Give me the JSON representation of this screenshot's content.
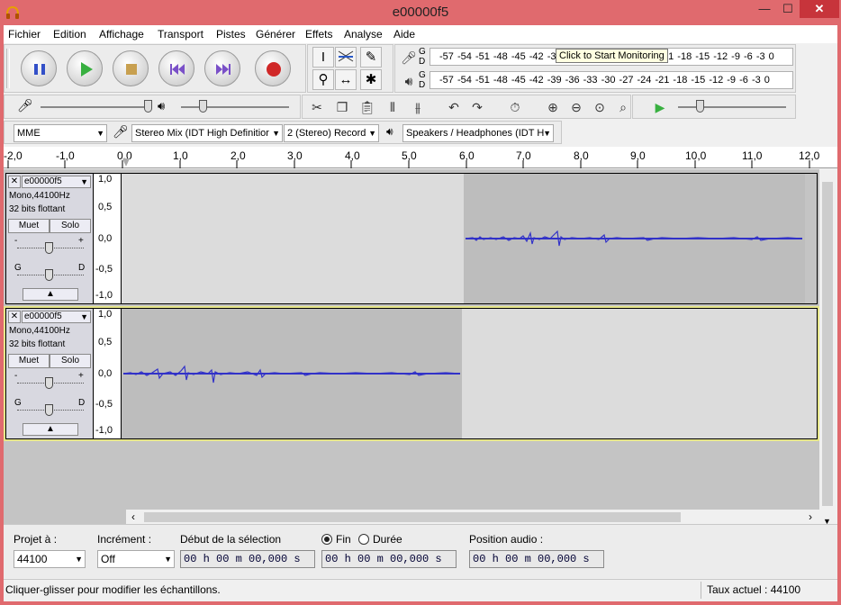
{
  "window": {
    "title": "e00000f5",
    "minimize": "—",
    "maximize": "☐",
    "close": "✕"
  },
  "menu": [
    "Fichier",
    "Edition",
    "Affichage",
    "Transport",
    "Pistes",
    "Générer",
    "Effets",
    "Analyse",
    "Aide"
  ],
  "meters": {
    "record_scale": "-57 -54 -51 -48 -45 -42 -3",
    "record_scale_tail": "21 -18 -15 -12 -9 -6 -3 0",
    "tooltip": "Click to Start Monitoring",
    "play_scale": "-57 -54 -51 -48 -45 -42 -39 -36 -33 -30 -27 -24 -21 -18 -15 -12 -9 -6 -3 0",
    "g": "G",
    "d": "D"
  },
  "device": {
    "host": "MME",
    "input": "Stereo Mix (IDT High Definitior",
    "channels": "2 (Stereo) Record",
    "output": "Speakers / Headphones (IDT H"
  },
  "ruler": {
    "ticks": [
      "-2,0",
      "-1,0",
      "0,0",
      "1,0",
      "2,0",
      "3,0",
      "4,0",
      "5,0",
      "6,0",
      "7,0",
      "8,0",
      "9,0",
      "10,0",
      "11,0",
      "12,0"
    ]
  },
  "tracks": [
    {
      "name": "e00000f5",
      "format": "Mono,44100Hz",
      "depth": "32 bits flottant",
      "mute": "Muet",
      "solo": "Solo",
      "gain_minus": "-",
      "gain_plus": "+",
      "pan_left": "G",
      "pan_right": "D",
      "scale": [
        "1,0",
        "0,5",
        "0,0",
        "-0,5",
        "-1,0"
      ]
    },
    {
      "name": "e00000f5",
      "format": "Mono,44100Hz",
      "depth": "32 bits flottant",
      "mute": "Muet",
      "solo": "Solo",
      "gain_minus": "-",
      "gain_plus": "+",
      "pan_left": "G",
      "pan_right": "D",
      "scale": [
        "1,0",
        "0,5",
        "0,0",
        "-0,5",
        "-1,0"
      ]
    }
  ],
  "selection": {
    "rate_label": "Projet à :",
    "rate_value": "44100",
    "snap_label": "Incrément :",
    "snap_value": "Off",
    "start_label": "Début de la sélection",
    "end_option": "Fin",
    "length_option": "Durée",
    "start_time": "00 h 00 m 00,000 s",
    "end_time": "00 h 00 m 00,000 s",
    "audio_pos_label": "Position audio :",
    "audio_pos": "00 h 00 m 00,000 s"
  },
  "status": {
    "message": "Cliquer-glisser pour modifier les échantillons.",
    "rate": "Taux actuel : 44100"
  },
  "colors": {
    "waveform": "#3232c8",
    "titlebar": "#e06a6e",
    "close": "#c7343b"
  }
}
